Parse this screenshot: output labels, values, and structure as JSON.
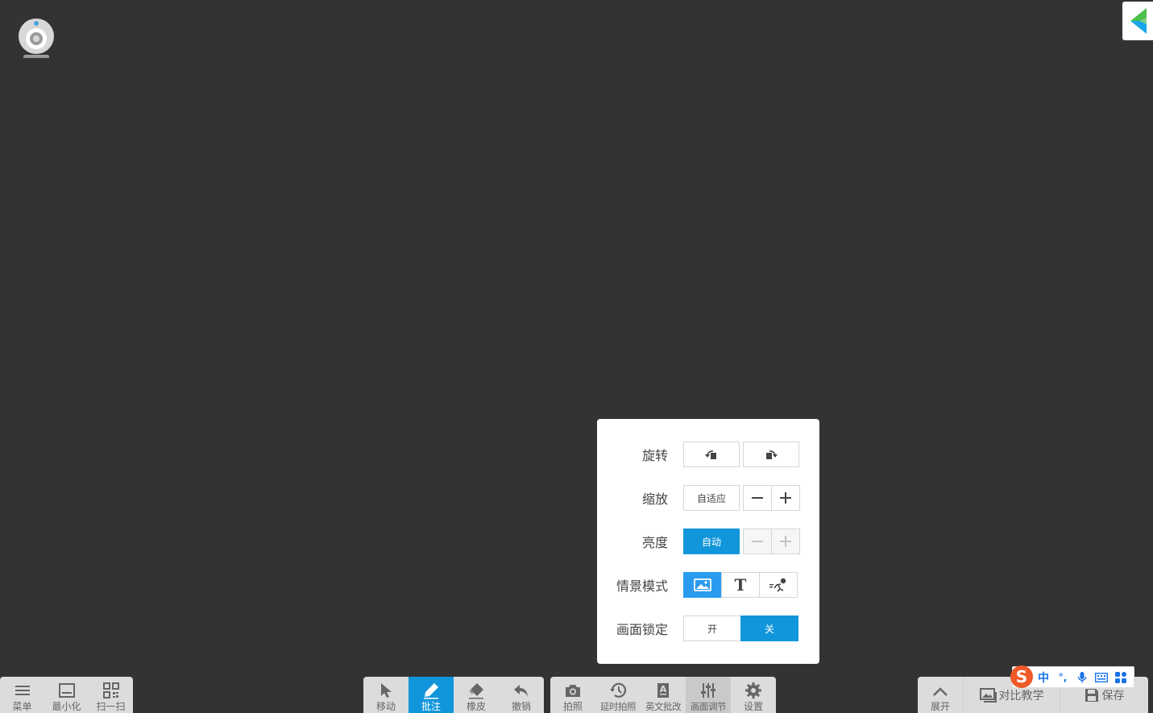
{
  "toolbar_left": [
    {
      "name": "menu",
      "label": "菜单",
      "icon": "menu-icon"
    },
    {
      "name": "minimize",
      "label": "最小化",
      "icon": "minimize-icon"
    },
    {
      "name": "scan",
      "label": "扫一扫",
      "icon": "qrcode-icon"
    }
  ],
  "toolbar_annot": [
    {
      "name": "move",
      "label": "移动",
      "icon": "cursor-icon"
    },
    {
      "name": "annotate",
      "label": "批注",
      "icon": "pen-icon",
      "active": true
    },
    {
      "name": "eraser",
      "label": "橡皮",
      "icon": "eraser-icon"
    },
    {
      "name": "undo",
      "label": "撤销",
      "icon": "undo-icon"
    }
  ],
  "toolbar_photo": [
    {
      "name": "photo",
      "label": "拍照",
      "icon": "camera-icon"
    },
    {
      "name": "delayed-photo",
      "label": "延时拍照",
      "icon": "timer-icon"
    },
    {
      "name": "english-correction",
      "label": "英文批改",
      "icon": "document-a-icon"
    },
    {
      "name": "picture-adjust",
      "label": "画面调节",
      "icon": "sliders-icon",
      "pressed": true
    },
    {
      "name": "settings",
      "label": "设置",
      "icon": "gear-icon"
    }
  ],
  "toolbar_right": {
    "expand_label": "展开",
    "compare_label": "对比教学",
    "save_label": "保存"
  },
  "panel": {
    "rotate_label": "旋转",
    "zoom_label": "缩放",
    "zoom_fit": "自适应",
    "brightness_label": "亮度",
    "brightness_auto": "自动",
    "scene_label": "情景模式",
    "scene_text_glyph": "T",
    "lock_label": "画面锁定",
    "lock_on": "开",
    "lock_off": "关"
  },
  "ime": {
    "mode": "中",
    "punct": "°,"
  },
  "colors": {
    "accent": "#1296db",
    "background": "#333333",
    "toolbar": "#dcdcdc"
  }
}
